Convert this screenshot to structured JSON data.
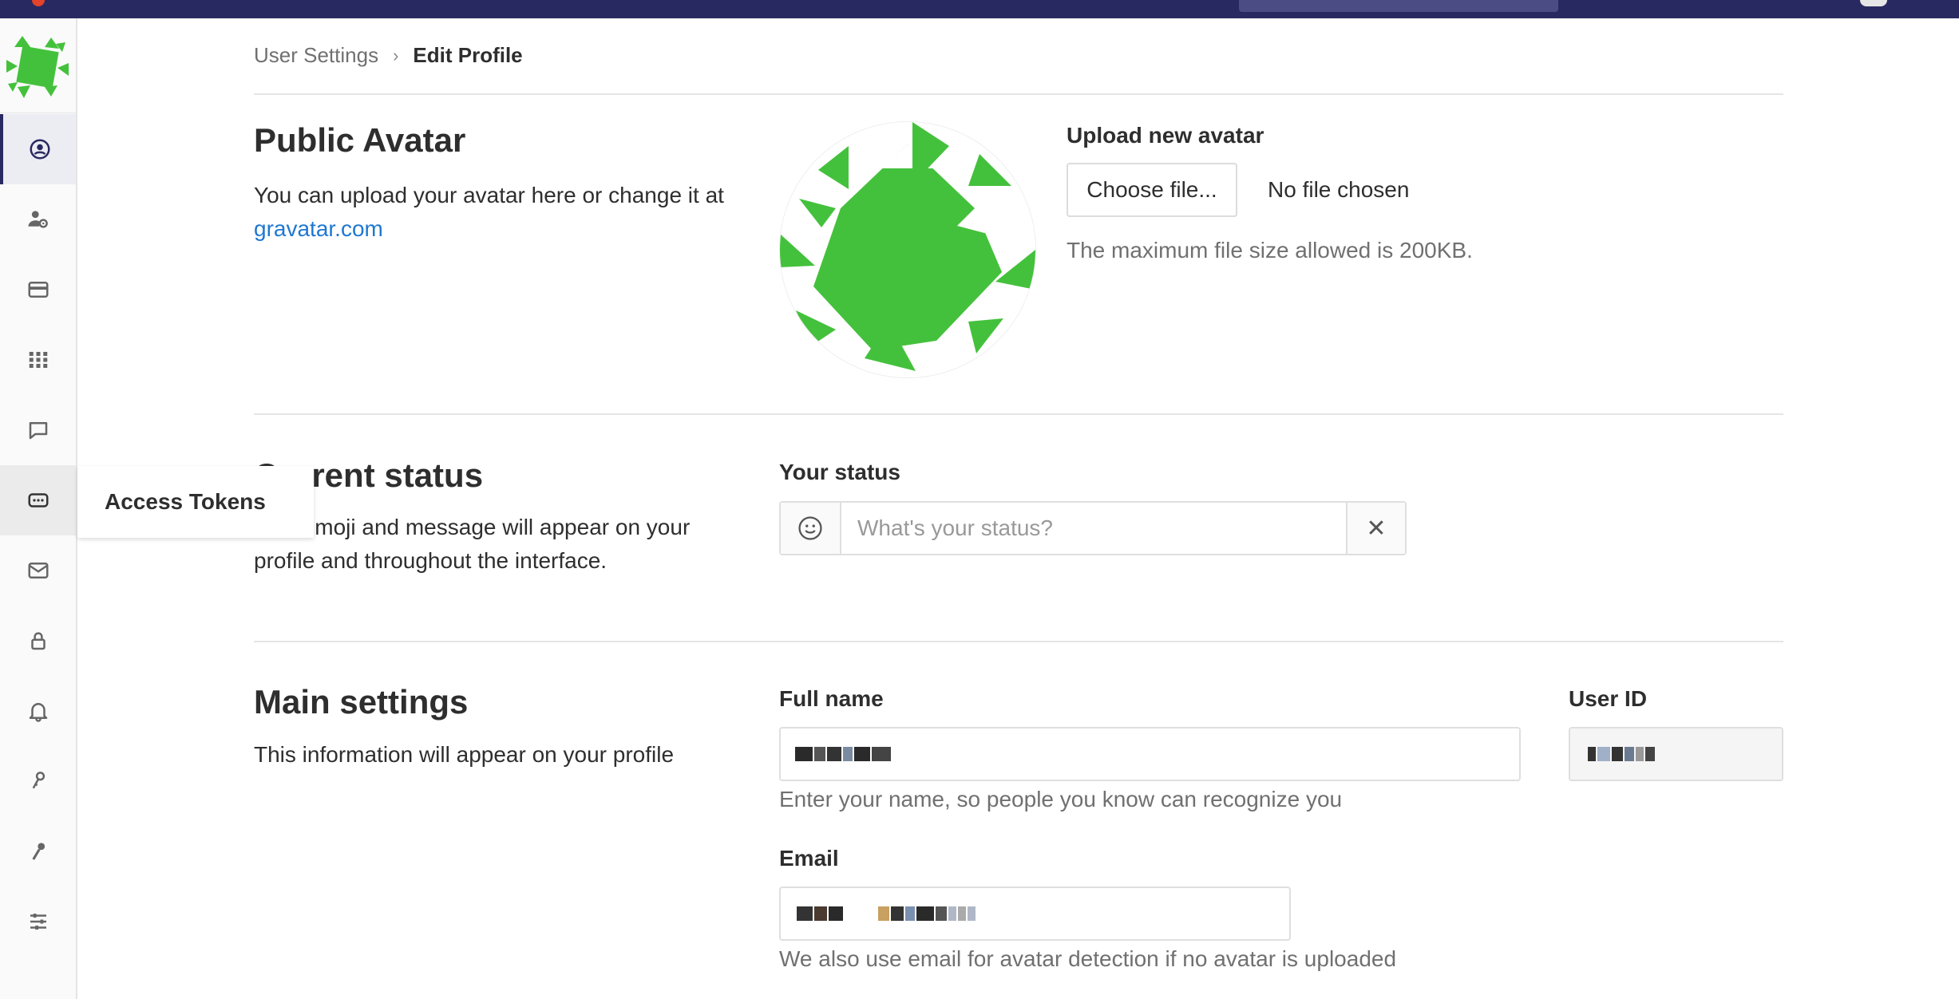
{
  "breadcrumb": {
    "parent": "User Settings",
    "separator": "›",
    "current": "Edit Profile"
  },
  "sidebar": {
    "items": [
      {
        "icon": "profile-icon",
        "active": true
      },
      {
        "icon": "account-icon"
      },
      {
        "icon": "billing-icon"
      },
      {
        "icon": "applications-icon"
      },
      {
        "icon": "chat-icon"
      },
      {
        "icon": "access-tokens-icon",
        "hovered": true
      },
      {
        "icon": "emails-icon"
      },
      {
        "icon": "password-icon"
      },
      {
        "icon": "notifications-icon"
      },
      {
        "icon": "ssh-keys-icon"
      },
      {
        "icon": "gpg-keys-icon"
      },
      {
        "icon": "preferences-icon"
      }
    ],
    "tooltip": "Access Tokens"
  },
  "avatar_section": {
    "title": "Public Avatar",
    "desc_prefix": "You can upload your avatar here or change it at ",
    "desc_link": "gravatar.com",
    "upload_label": "Upload new avatar",
    "choose_button": "Choose file...",
    "no_file": "No file chosen",
    "max_size_hint": "The maximum file size allowed is 200KB."
  },
  "status_section": {
    "title": "Current status",
    "desc": "This emoji and message will appear on your profile and throughout the interface.",
    "label": "Your status",
    "placeholder": "What's your status?",
    "clear": "✕"
  },
  "main_section": {
    "title": "Main settings",
    "desc": "This information will appear on your profile",
    "full_name_label": "Full name",
    "full_name_hint": "Enter your name, so people you know can recognize you",
    "user_id_label": "User ID",
    "email_label": "Email",
    "email_hint": "We also use email for avatar detection if no avatar is uploaded"
  },
  "colors": {
    "topbar": "#292961",
    "accent_link": "#1f78d1",
    "avatar_green": "#44c13c"
  }
}
